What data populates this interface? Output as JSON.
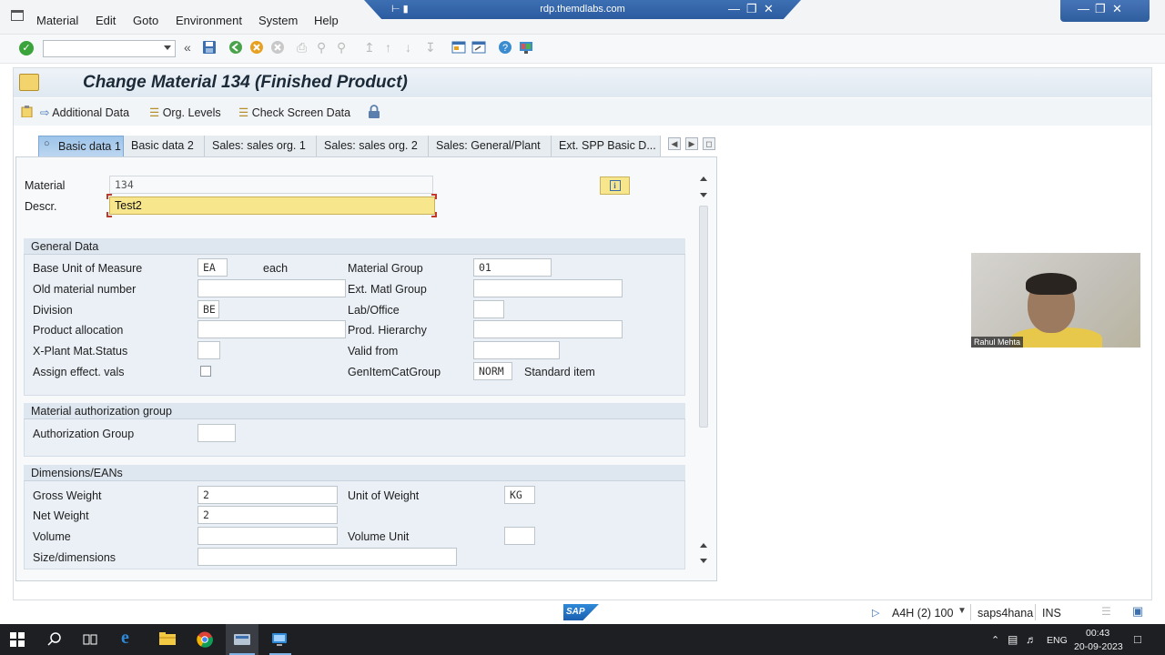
{
  "menubar": {
    "items": [
      "Material",
      "Edit",
      "Goto",
      "Environment",
      "System",
      "Help"
    ]
  },
  "rdp": {
    "host": "rdp.themdlabs.com"
  },
  "title": "Change Material 134 (Finished Product)",
  "app_toolbar": {
    "additional_data": "Additional Data",
    "org_levels": "Org. Levels",
    "check_screen_data": "Check Screen Data"
  },
  "tabs": [
    "Basic data 1",
    "Basic data 2",
    "Sales: sales org. 1",
    "Sales: sales org. 2",
    "Sales: General/Plant",
    "Ext. SPP Basic D..."
  ],
  "header": {
    "material_label": "Material",
    "material_value": "134",
    "descr_label": "Descr.",
    "descr_value": "Test2"
  },
  "general_data": {
    "title": "General Data",
    "base_uom_label": "Base Unit of Measure",
    "base_uom_value": "EA",
    "base_uom_text": "each",
    "material_group_label": "Material Group",
    "material_group_value": "01",
    "old_material_label": "Old material number",
    "ext_matl_group_label": "Ext. Matl Group",
    "division_label": "Division",
    "division_value": "BE",
    "lab_office_label": "Lab/Office",
    "product_allocation_label": "Product allocation",
    "prod_hierarchy_label": "Prod. Hierarchy",
    "xplant_status_label": "X-Plant Mat.Status",
    "valid_from_label": "Valid from",
    "assign_effect_label": "Assign effect. vals",
    "gen_item_cat_label": "GenItemCatGroup",
    "gen_item_cat_value": "NORM",
    "gen_item_cat_text": "Standard item"
  },
  "auth_group": {
    "title": "Material authorization group",
    "label": "Authorization Group"
  },
  "dimensions": {
    "title": "Dimensions/EANs",
    "gross_weight_label": "Gross Weight",
    "gross_weight_value": "2",
    "unit_of_weight_label": "Unit of Weight",
    "unit_of_weight_value": "KG",
    "net_weight_label": "Net Weight",
    "net_weight_value": "2",
    "volume_label": "Volume",
    "volume_unit_label": "Volume Unit",
    "size_label": "Size/dimensions"
  },
  "webcam": {
    "name": "Rahul Mehta"
  },
  "status_bar": {
    "system": "A4H (2) 100",
    "server": "saps4hana",
    "mode": "INS",
    "sap_logo": "SAP"
  },
  "taskbar": {
    "language": "ENG",
    "time": "00:43",
    "date": "20-09-2023"
  },
  "colors": {
    "highlight_field": "#f8e68c",
    "active_tab": "#9cc4ea",
    "taskbar": "#1d1f23"
  }
}
